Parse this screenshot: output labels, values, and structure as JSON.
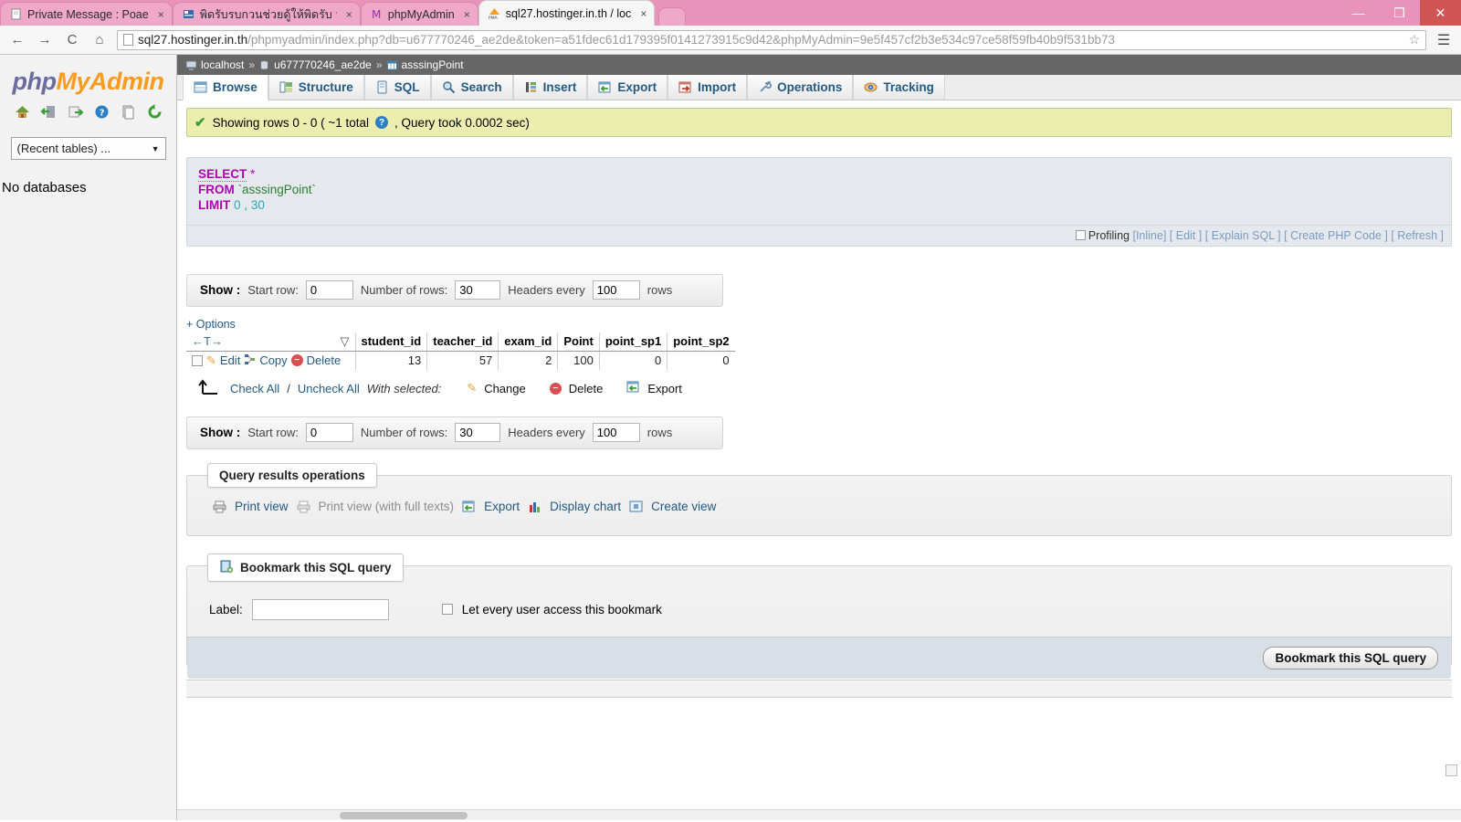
{
  "browser": {
    "tabs": [
      {
        "label": "Private Message : Poae",
        "icon": "page-icon",
        "active": false
      },
      {
        "label": "พิดรับรบกวนช่วยดู้ให้พิดรับ ว่า",
        "icon": "forum-icon",
        "active": false
      },
      {
        "label": "phpMyAdmin",
        "icon": "pma-tab-icon",
        "active": false
      },
      {
        "label": "sql27.hostinger.in.th / loc",
        "icon": "pma-icon",
        "active": true
      }
    ],
    "close_glyph": "×",
    "window_controls": {
      "minimize": "—",
      "maximize": "❐",
      "close": "✕"
    },
    "nav": {
      "back": "←",
      "forward": "→",
      "reload": "C",
      "home": "⌂"
    },
    "url_host": "sql27.hostinger.in.th",
    "url_path": "/phpmyadmin/index.php?db=u677770246_ae2de&token=a51fdec61d179395f0141273915c9d42&phpMyAdmin=9e5f457cf2b3e534c97ce58f59fb40b9f531bb73",
    "star": "☆",
    "menu": "☰"
  },
  "sidebar": {
    "logo_php": "php",
    "logo_my": "MyAdmin",
    "icons": [
      "home-icon",
      "logout-icon",
      "export-icon",
      "help-icon",
      "docs-icon",
      "reload-icon"
    ],
    "recent_tables": "(Recent tables) ...",
    "recent_caret": "▼",
    "no_databases": "No databases"
  },
  "breadcrumb": {
    "server": "localhost",
    "database": "u677770246_ae2de",
    "table": "asssingPoint",
    "separator": "»"
  },
  "tabs": [
    {
      "label": "Browse",
      "icon": "browse-icon",
      "active": true
    },
    {
      "label": "Structure",
      "icon": "structure-icon",
      "active": false
    },
    {
      "label": "SQL",
      "icon": "sql-icon",
      "active": false
    },
    {
      "label": "Search",
      "icon": "search-icon",
      "active": false
    },
    {
      "label": "Insert",
      "icon": "insert-icon",
      "active": false
    },
    {
      "label": "Export",
      "icon": "export-icon",
      "active": false
    },
    {
      "label": "Import",
      "icon": "import-icon",
      "active": false
    },
    {
      "label": "Operations",
      "icon": "operations-icon",
      "active": false
    },
    {
      "label": "Tracking",
      "icon": "tracking-icon",
      "active": false
    }
  ],
  "status": {
    "rows_text": "Showing rows 0 - 0 ( ~1 total",
    "help_glyph": "?",
    "query_time": ", Query took 0.0002 sec)"
  },
  "sql": {
    "select_kw": "SELECT",
    "star": "*",
    "from_kw": "FROM",
    "table_ident": "`asssingPoint`",
    "limit_kw": "LIMIT",
    "limit_start": "0",
    "limit_comma": ",",
    "limit_count": "30",
    "profiling_label": "Profiling",
    "links": [
      "[Inline]",
      "[ Edit ]",
      "[ Explain SQL ]",
      "[ Create PHP Code ]",
      "[ Refresh ]"
    ]
  },
  "show_bar": {
    "show_label": "Show :",
    "start_row_label": "Start row:",
    "start_row_value": "0",
    "num_rows_label": "Number of rows:",
    "num_rows_value": "30",
    "headers_label": "Headers every",
    "headers_value": "100",
    "rows_suffix": "rows"
  },
  "table": {
    "options_label": "+ Options",
    "sort_marker": "←T→",
    "sort_caret": "▽",
    "columns": [
      "student_id",
      "teacher_id",
      "exam_id",
      "Point",
      "point_sp1",
      "point_sp2"
    ],
    "rows": [
      {
        "actions": [
          "Edit",
          "Copy",
          "Delete"
        ],
        "values": [
          "13",
          "57",
          "2",
          "100",
          "0",
          "0"
        ]
      }
    ],
    "check_all": "Check All",
    "slash": "/",
    "uncheck_all": "Uncheck All",
    "with_selected": "With selected:",
    "bulk_actions": [
      "Change",
      "Delete",
      "Export"
    ]
  },
  "query_ops": {
    "legend": "Query results operations",
    "links": [
      {
        "label": "Print view",
        "icon": "printer-icon",
        "disabled": false
      },
      {
        "label": "Print view (with full texts)",
        "icon": "printer-icon",
        "disabled": true
      },
      {
        "label": "Export",
        "icon": "export-icon",
        "disabled": false
      },
      {
        "label": "Display chart",
        "icon": "chart-icon",
        "disabled": false
      },
      {
        "label": "Create view",
        "icon": "view-icon",
        "disabled": false
      }
    ]
  },
  "bookmark": {
    "legend": "Bookmark this SQL query",
    "legend_icon": "bookmark-icon",
    "label_text": "Label:",
    "label_value": "",
    "checkbox_label": "Let every user access this bookmark",
    "submit_label": "Bookmark this SQL query"
  }
}
